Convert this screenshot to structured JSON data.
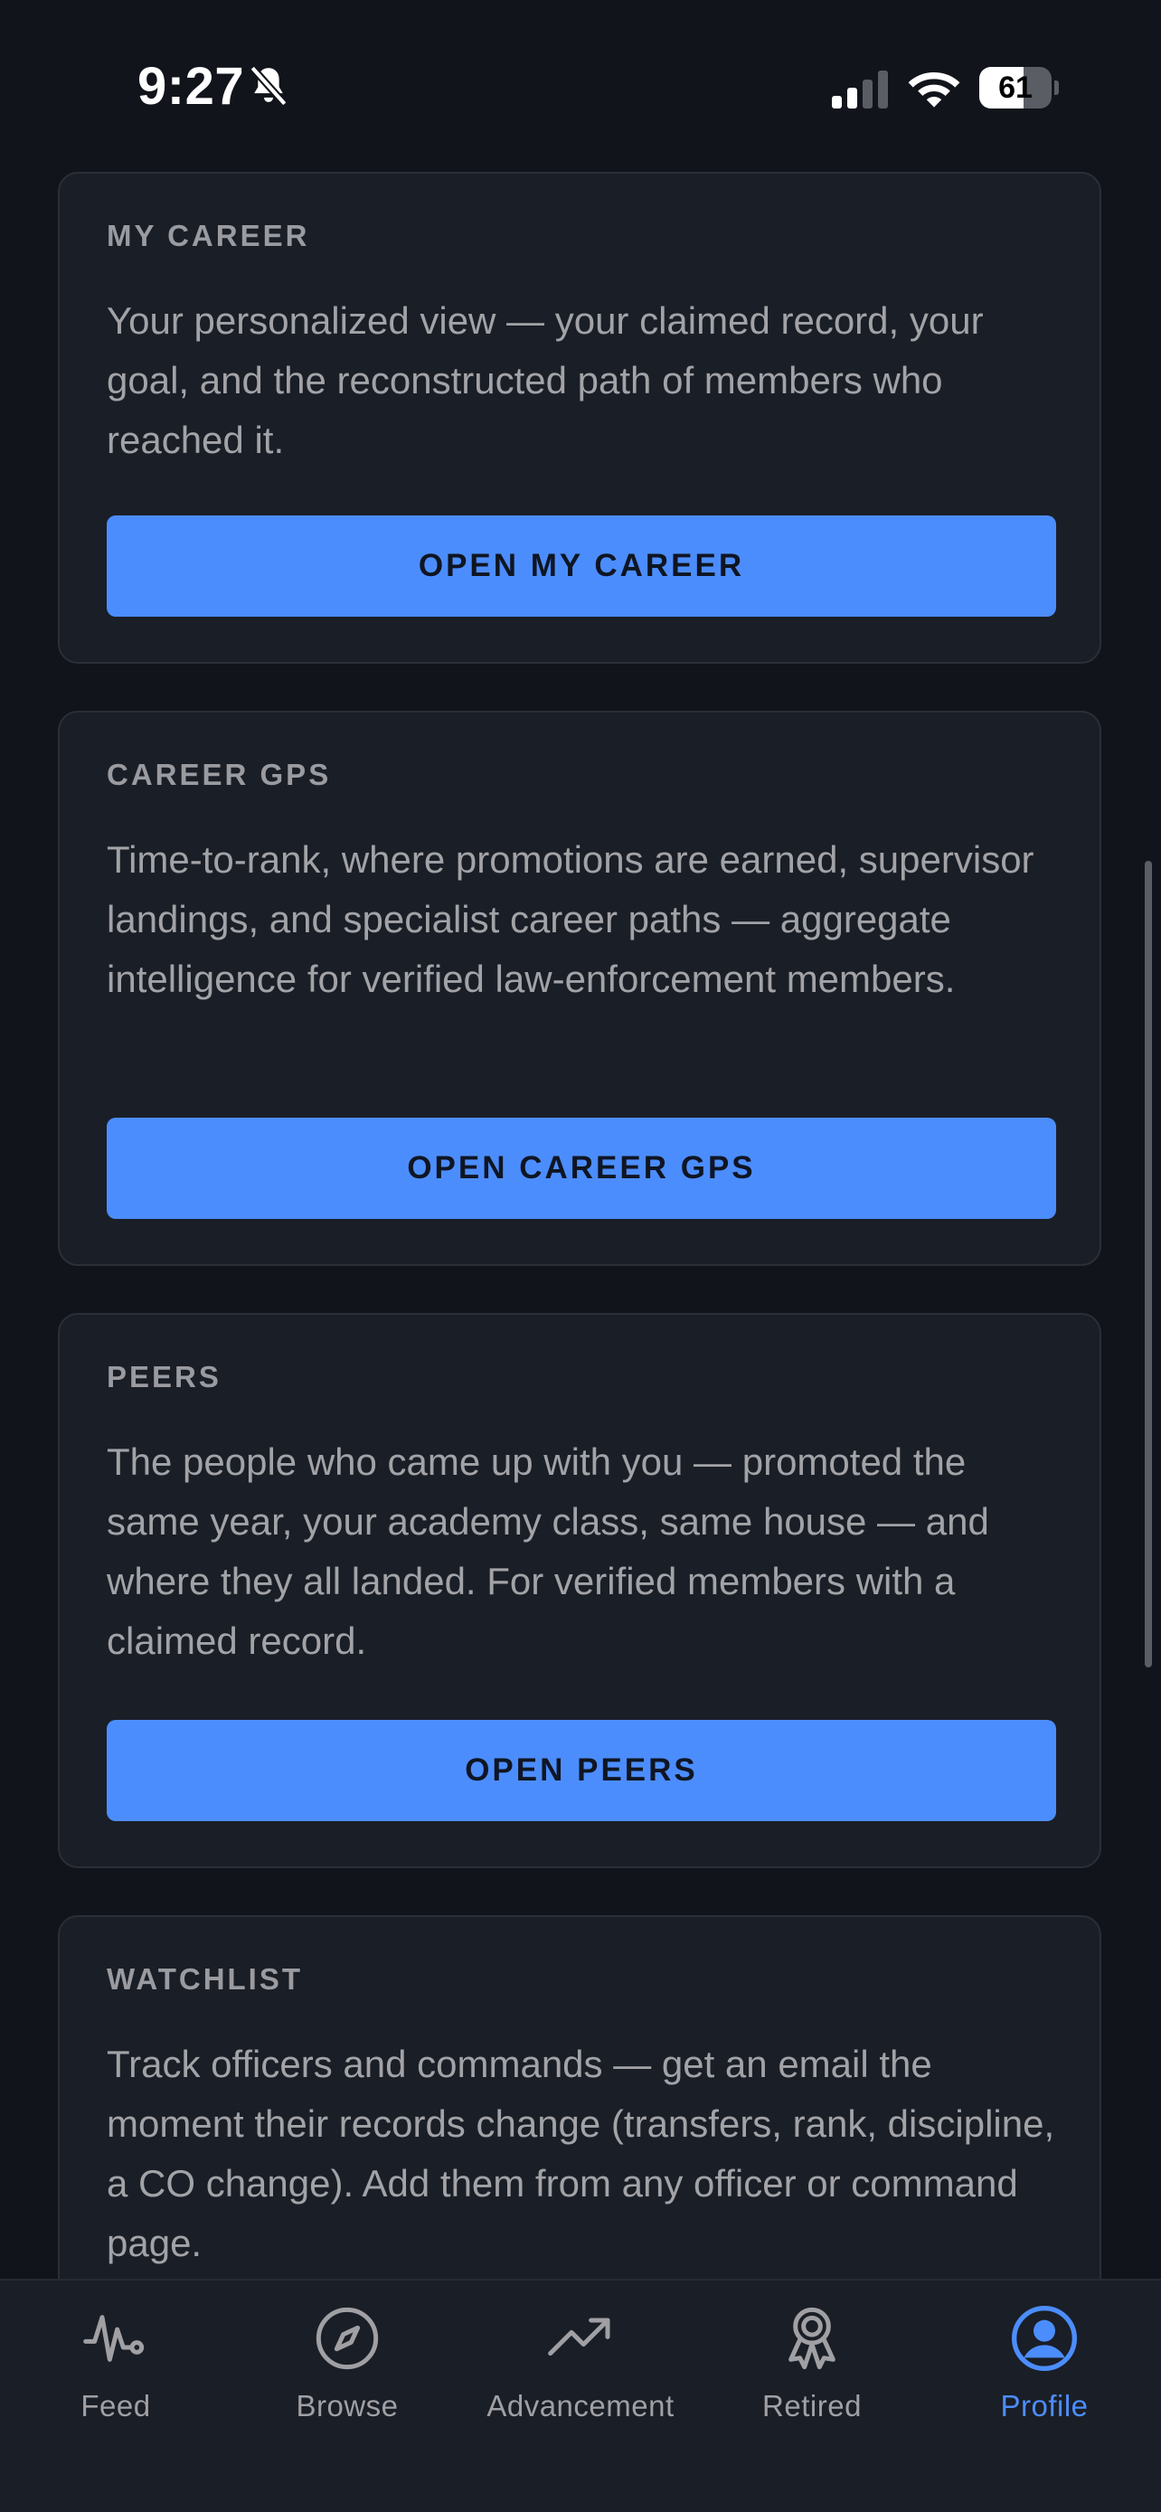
{
  "status_bar": {
    "time": "9:27",
    "battery_level": "61",
    "battery_fraction": 0.61
  },
  "cards": [
    {
      "label": "MY CAREER",
      "description": "Your personalized view — your claimed record, your goal, and the reconstructed path of members who reached it.",
      "button": "OPEN MY CAREER"
    },
    {
      "label": "CAREER GPS",
      "description": "Time-to-rank, where promotions are earned, supervisor landings, and specialist career paths — aggregate intelligence for verified law-enforcement members.",
      "button": "OPEN CAREER GPS"
    },
    {
      "label": "PEERS",
      "description": "The people who came up with you — promoted the same year, your academy class, same house — and where they all landed. For verified members with a claimed record.",
      "button": "OPEN PEERS"
    },
    {
      "label": "WATCHLIST",
      "description": "Track officers and commands — get an email the moment their records change (transfers, rank, discipline, a CO change). Add them from any officer or command page."
    }
  ],
  "tabs": [
    {
      "label": "Feed",
      "icon": "pulse-icon"
    },
    {
      "label": "Browse",
      "icon": "compass-icon"
    },
    {
      "label": "Advancement",
      "icon": "trending-up-icon"
    },
    {
      "label": "Retired",
      "icon": "award-ribbon-icon"
    },
    {
      "label": "Profile",
      "icon": "user-circle-icon",
      "active": true
    }
  ],
  "colors": {
    "background": "#11141a",
    "card": "#1a1e26",
    "accent": "#4c8dfd",
    "text_muted": "#a2a3a7"
  }
}
